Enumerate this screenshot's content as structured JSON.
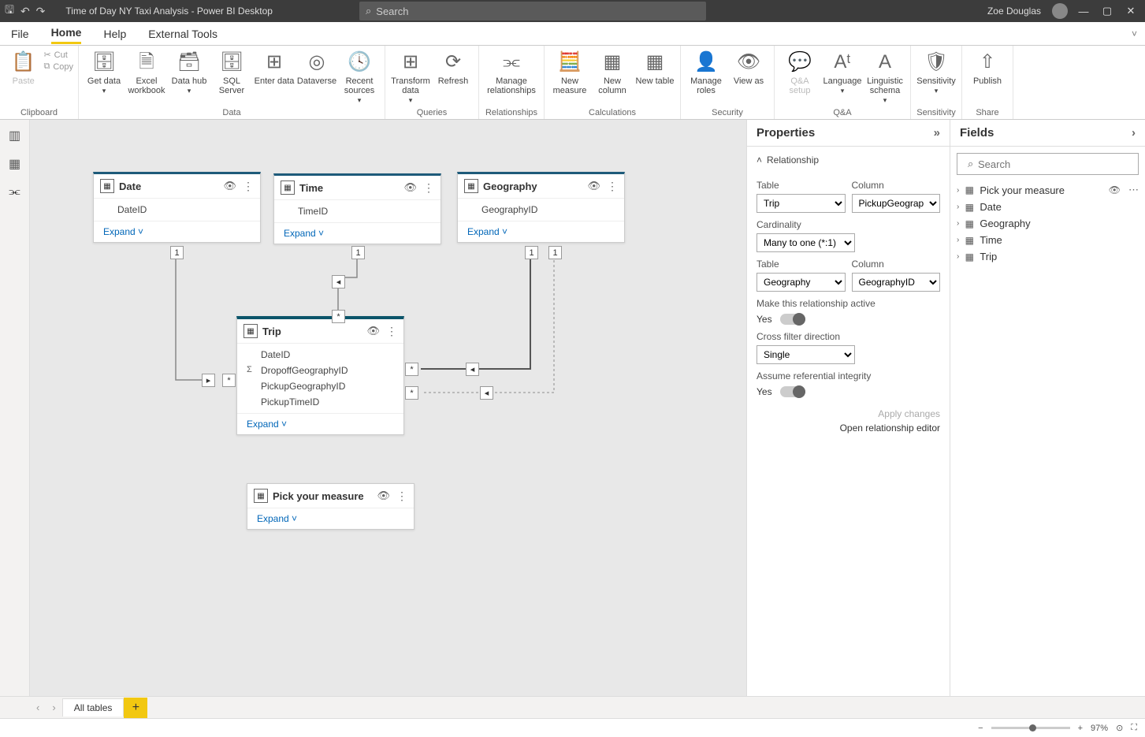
{
  "titlebar": {
    "title": "Time of Day NY Taxi Analysis - Power BI Desktop",
    "search_placeholder": "Search",
    "user": "Zoe Douglas"
  },
  "ribbon_tabs": [
    "File",
    "Home",
    "Help",
    "External Tools"
  ],
  "ribbon": {
    "clipboard": {
      "label": "Clipboard",
      "paste": "Paste",
      "cut": "Cut",
      "copy": "Copy"
    },
    "data": {
      "label": "Data",
      "get_data": "Get data",
      "excel": "Excel workbook",
      "hub": "Data hub",
      "sql": "SQL Server",
      "enter": "Enter data",
      "dataverse": "Dataverse",
      "recent": "Recent sources"
    },
    "queries": {
      "label": "Queries",
      "transform": "Transform data",
      "refresh": "Refresh"
    },
    "relationships": {
      "label": "Relationships",
      "manage": "Manage relationships"
    },
    "calculations": {
      "label": "Calculations",
      "measure": "New measure",
      "column": "New column",
      "table": "New table"
    },
    "security": {
      "label": "Security",
      "roles": "Manage roles",
      "viewas": "View as"
    },
    "qna": {
      "label": "Q&A",
      "setup": "Q&A setup",
      "language": "Language",
      "schema": "Linguistic schema"
    },
    "sensitivity": {
      "label": "Sensitivity",
      "btn": "Sensitivity"
    },
    "share": {
      "label": "Share",
      "publish": "Publish"
    }
  },
  "canvas": {
    "tables": {
      "date": {
        "name": "Date",
        "cols": [
          "DateID"
        ],
        "expand": "Expand"
      },
      "time": {
        "name": "Time",
        "cols": [
          "TimeID"
        ],
        "expand": "Expand"
      },
      "geography": {
        "name": "Geography",
        "cols": [
          "GeographyID"
        ],
        "expand": "Expand"
      },
      "trip": {
        "name": "Trip",
        "cols": [
          "DateID",
          "DropoffGeographyID",
          "PickupGeographyID",
          "PickupTimeID"
        ],
        "expand": "Expand"
      },
      "pick": {
        "name": "Pick your measure",
        "expand": "Expand"
      }
    }
  },
  "properties": {
    "title": "Properties",
    "section": "Relationship",
    "labels": {
      "table": "Table",
      "column": "Column",
      "cardinality": "Cardinality",
      "active": "Make this relationship active",
      "cross": "Cross filter direction",
      "referential": "Assume referential integrity",
      "yes": "Yes"
    },
    "values": {
      "table1": "Trip",
      "column1": "PickupGeographyID",
      "cardinality": "Many to one (*:1)",
      "table2": "Geography",
      "column2": "GeographyID",
      "cross": "Single"
    },
    "links": {
      "apply": "Apply changes",
      "editor": "Open relationship editor"
    }
  },
  "fields": {
    "title": "Fields",
    "search_placeholder": "Search",
    "items": [
      {
        "name": "Pick your measure",
        "eye": true
      },
      {
        "name": "Date"
      },
      {
        "name": "Geography"
      },
      {
        "name": "Time"
      },
      {
        "name": "Trip"
      }
    ]
  },
  "bottom": {
    "tab": "All tables"
  },
  "status": {
    "zoom": "97%"
  }
}
